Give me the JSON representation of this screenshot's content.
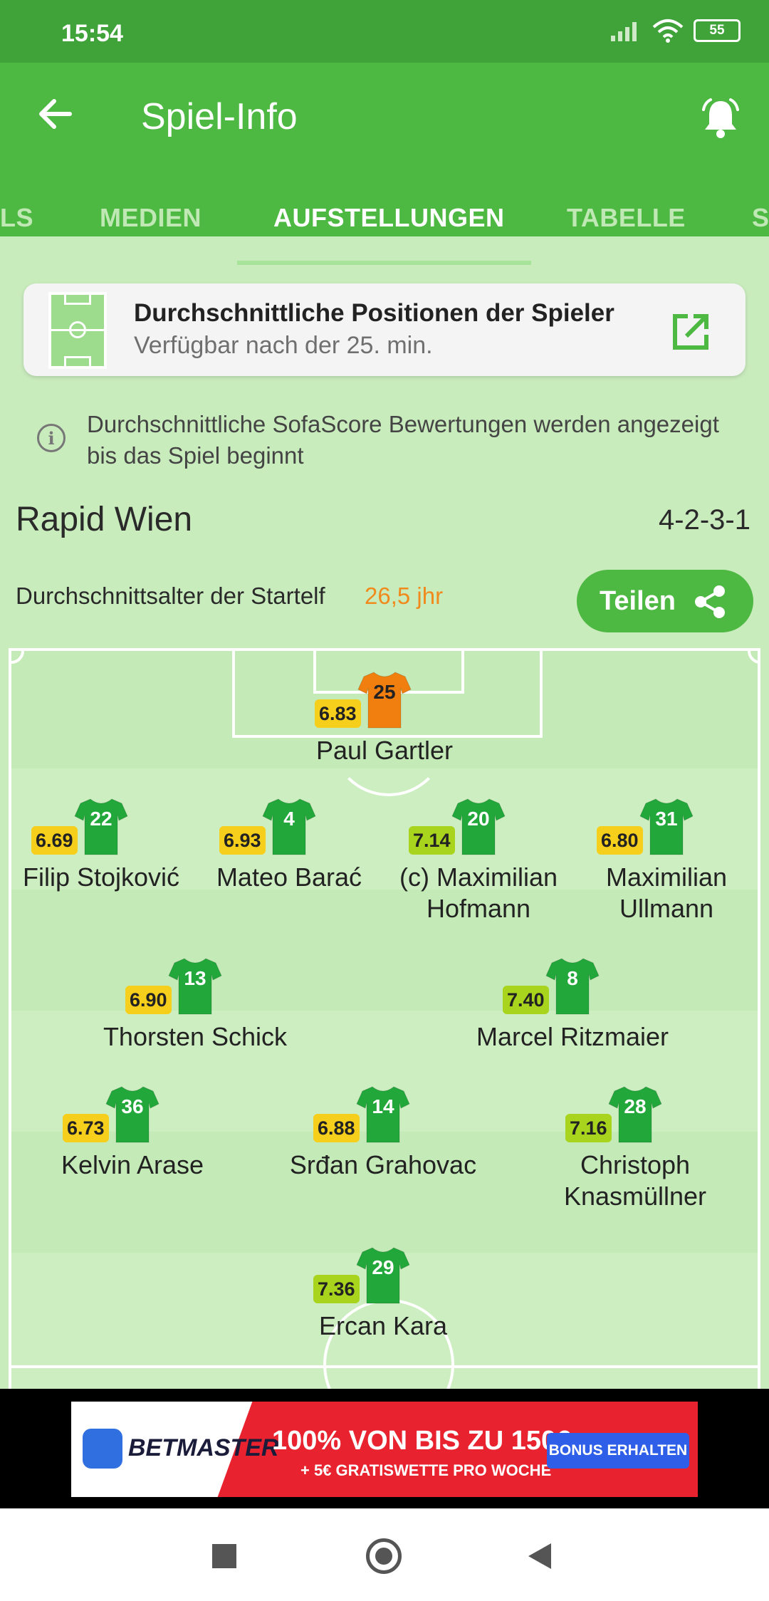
{
  "status": {
    "time": "15:54",
    "battery": "55"
  },
  "header": {
    "title": "Spiel-Info"
  },
  "tabs": [
    {
      "label": "LS"
    },
    {
      "label": "MEDIEN"
    },
    {
      "label": "AUFSTELLUNGEN",
      "active": true
    },
    {
      "label": "TABELLE"
    },
    {
      "label": "S"
    }
  ],
  "avg_positions": {
    "title": "Durchschnittliche Positionen der Spieler",
    "subtitle": "Verfügbar nach der 25. min."
  },
  "info": {
    "text": "Durchschnittliche SofaScore Bewertungen werden angezeigt bis das Spiel beginnt"
  },
  "team": {
    "name": "Rapid Wien",
    "formation": "4-2-3-1",
    "avg_age_label": "Durchschnittsalter der Startelf",
    "avg_age_value": "26,5 jhr",
    "share_label": "Teilen"
  },
  "players": [
    {
      "number": "25",
      "rating": "6.83",
      "name": "Paul Gartler",
      "keeper": true
    },
    {
      "number": "22",
      "rating": "6.69",
      "name": "Filip Stojković"
    },
    {
      "number": "4",
      "rating": "6.93",
      "name": "Mateo Barać"
    },
    {
      "number": "20",
      "rating": "7.14",
      "name": "(c) Maximilian Hofmann"
    },
    {
      "number": "31",
      "rating": "6.80",
      "name": "Maximilian Ullmann"
    },
    {
      "number": "13",
      "rating": "6.90",
      "name": "Thorsten Schick"
    },
    {
      "number": "8",
      "rating": "7.40",
      "name": "Marcel Ritzmaier"
    },
    {
      "number": "36",
      "rating": "6.73",
      "name": "Kelvin Arase"
    },
    {
      "number": "14",
      "rating": "6.88",
      "name": "Srđan Grahovac"
    },
    {
      "number": "28",
      "rating": "7.16",
      "name": "Christoph Knasmüllner"
    },
    {
      "number": "29",
      "rating": "7.36",
      "name": "Ercan Kara"
    }
  ],
  "colors": {
    "rating_yellow": "#f5cf1b",
    "rating_green": "#a8d41d",
    "shirt_green": "#21a73a",
    "shirt_keeper": "#f07f10",
    "accent": "#4db842"
  },
  "ad": {
    "brand": "BETMASTER",
    "headline": "100% VON BIS ZU 150€",
    "subline": "+ 5€ GRATISWETTE PRO WOCHE",
    "button": "BONUS ERHALTEN"
  }
}
